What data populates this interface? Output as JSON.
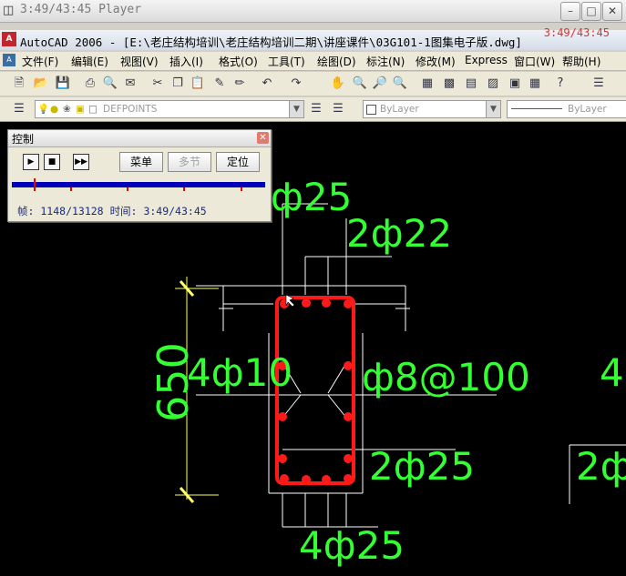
{
  "player": {
    "title": "3:49/43:45 Player"
  },
  "cad": {
    "title": "AutoCAD 2006 - [E:\\老庄结构培训\\老庄结构培训二期\\讲座课件\\03G101-1图集电子版.dwg]",
    "overlay_time": "3:49/43:45"
  },
  "menu": [
    "文件(F)",
    "编辑(E)",
    "视图(V)",
    "插入(I)",
    "格式(O)",
    "工具(T)",
    "绘图(D)",
    "标注(N)",
    "修改(M)",
    "Express",
    "窗口(W)",
    "帮助(H)"
  ],
  "layers": {
    "current": "DEFPOINTS",
    "color": "ByLayer",
    "linetype": "ByLayer"
  },
  "control": {
    "title": "控制",
    "buttons": {
      "menu": "菜单",
      "multi": "多节",
      "locate": "定位"
    },
    "frame_label": "帧:",
    "frame_value": "1148/13128",
    "time_label": "时间:",
    "time_value": "3:49/43:45",
    "progress": 0.0874
  },
  "drawing": {
    "labels": {
      "top_bars": "ф25",
      "top_middle_bars": "2ф22",
      "height": "650",
      "side_bars": "4ф10",
      "stirrup": "ф8@100",
      "bottom_second": "2ф25",
      "bottom_bars": "4ф25",
      "right_partial_top": "4",
      "right_partial_bottom": "2ф"
    },
    "colors": {
      "rebar": "#ff1a1a",
      "text": "#33ff33",
      "lines": "#ffffff",
      "dims": "#ffff66"
    }
  }
}
